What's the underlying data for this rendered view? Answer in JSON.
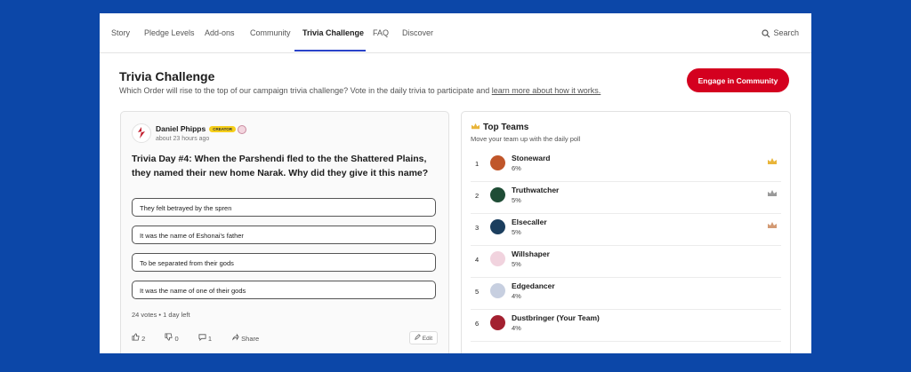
{
  "nav": {
    "tabs": [
      {
        "label": "Story"
      },
      {
        "label": "Pledge Levels"
      },
      {
        "label": "Add-ons"
      },
      {
        "label": "Community"
      },
      {
        "label": "Trivia Challenge",
        "active": true
      },
      {
        "label": "FAQ"
      },
      {
        "label": "Discover"
      }
    ],
    "search_label": "Search"
  },
  "header": {
    "title": "Trivia Challenge",
    "subtitle": "Which Order will rise to the top of our campaign trivia challenge? Vote in the daily trivia to participate and ",
    "subtitle_link": "learn more about how it works.",
    "cta_label": "Engage in Community"
  },
  "post": {
    "author": "Daniel Phipps",
    "badge": "CREATOR",
    "time": "about 23 hours ago",
    "question": "Trivia Day #4: When the Parshendi fled to the the Shattered Plains, they named their new home Narak. Why did they give it this name?",
    "options": [
      "They felt betrayed by the spren",
      "It was the name of Eshonai's father",
      "To be separated from their gods",
      "It was the name of one of their gods"
    ],
    "votes_text": "24 votes • 1 day left",
    "likes": "2",
    "dislikes": "0",
    "comments": "1",
    "share_label": "Share",
    "edit_label": "Edit"
  },
  "teams": {
    "title": "Top Teams",
    "subtitle": "Move your team up with the daily poll",
    "rows": [
      {
        "rank": "1",
        "name": "Stoneward",
        "pct": "6%",
        "color": "#c0562a",
        "crown": "#e9b53a"
      },
      {
        "rank": "2",
        "name": "Truthwatcher",
        "pct": "5%",
        "color": "#1f4d36",
        "crown": "#9a9a9a"
      },
      {
        "rank": "3",
        "name": "Elsecaller",
        "pct": "5%",
        "color": "#1b3e5e",
        "crown": "#d39a74"
      },
      {
        "rank": "4",
        "name": "Willshaper",
        "pct": "5%",
        "color": "#f1d3de"
      },
      {
        "rank": "5",
        "name": "Edgedancer",
        "pct": "4%",
        "color": "#c7cfe0"
      },
      {
        "rank": "6",
        "name": "Dustbringer (Your Team)",
        "pct": "4%",
        "color": "#a32030"
      }
    ]
  }
}
